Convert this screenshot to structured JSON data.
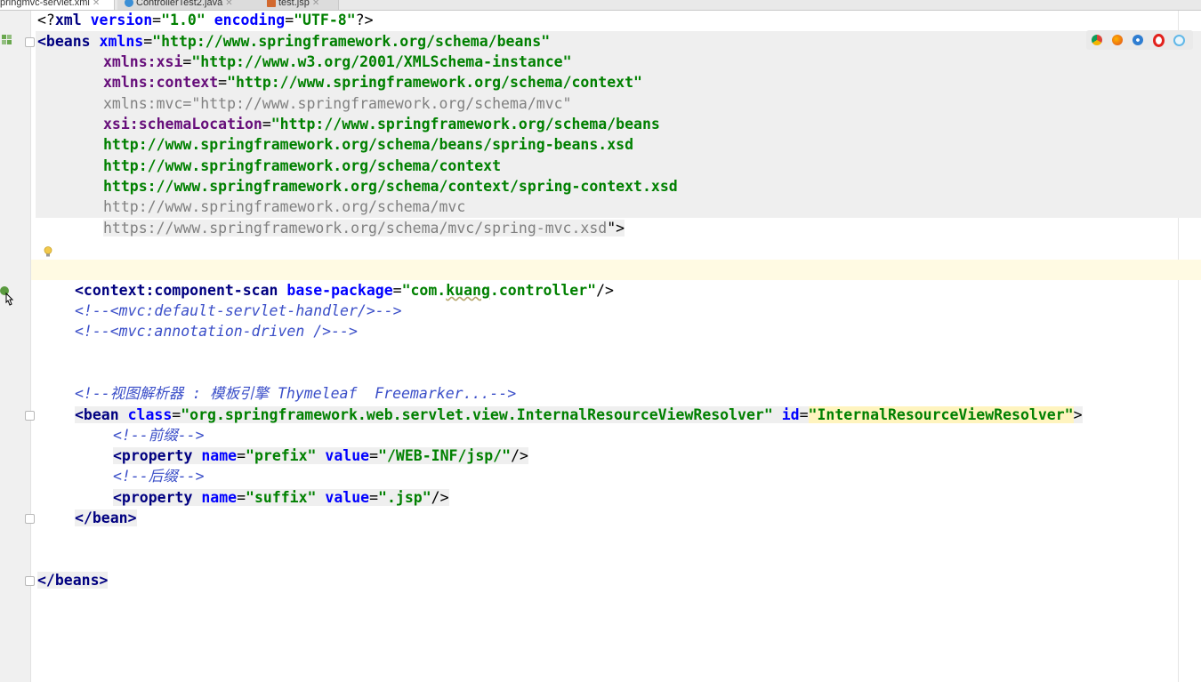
{
  "tabs": [
    {
      "label": "pringmvc-servlet.xml"
    },
    {
      "label": "ControllerTest2.java"
    },
    {
      "label": "test.jsp"
    }
  ],
  "browser_icons": [
    "chrome-icon",
    "firefox-icon",
    "safari-icon",
    "opera-icon",
    "ie-icon"
  ],
  "code": {
    "l1_decl_open": "<?",
    "l1_xml": "xml",
    "l1_version_attr": " version",
    "l1_eq": "=",
    "l1_version_val": "\"1.0\"",
    "l1_encoding_attr": " encoding",
    "l1_encoding_val": "\"UTF-8\"",
    "l1_decl_close": "?>",
    "l2_open": "<beans",
    "l2_attr": " xmlns",
    "l2_val": "\"http://www.springframework.org/schema/beans\"",
    "l3_attr": "xmlns:xsi",
    "l3_val": "\"http://www.w3.org/2001/XMLSchema-instance\"",
    "l4_attr": "xmlns:context",
    "l4_val": "\"http://www.springframework.org/schema/context\"",
    "l5_text": "xmlns:mvc=\"http://www.springframework.org/schema/mvc\"",
    "l6_attr": "xsi:schemaLocation",
    "l6_val": "\"http://www.springframework.org/schema/beans",
    "l7_val": "http://www.springframework.org/schema/beans/spring-beans.xsd",
    "l8_val": "http://www.springframework.org/schema/context",
    "l9_val": "https://www.springframework.org/schema/context/spring-context.xsd",
    "l10_text": "http://www.springframework.org/schema/mvc",
    "l11_text": "https://www.springframework.org/schema/mvc/spring-mvc.xsd",
    "l11_end": "\">",
    "cs_open": "<context:component-scan",
    "cs_attr": " base-package",
    "cs_val_a": "\"com.",
    "cs_val_b": "kuang",
    "cs_val_c": ".controller\"",
    "cs_close": "/>",
    "cmt1": "<!--<mvc:default-servlet-handler/>-->",
    "cmt2": "<!--<mvc:annotation-driven />-->",
    "cmt3": "<!--视图解析器 : 模板引擎 Thymeleaf  Freemarker...-->",
    "bean_open": "<bean",
    "bean_class_attr": " class",
    "bean_class_val": "\"org.springframework.web.servlet.view.InternalResourceViewResolver\"",
    "bean_id_attr": " id",
    "bean_id_val": "\"InternalResourceViewResolver\"",
    "bean_gt": ">",
    "cmt_prefix": "<!--前缀-->",
    "prop_open": "<property",
    "name_attr": " name",
    "prefix_name_val": "\"prefix\"",
    "value_attr": " value",
    "prefix_value_val": "\"/WEB-INF/jsp/\"",
    "prop_close": "/>",
    "cmt_suffix": "<!--后缀-->",
    "suffix_name_val": "\"suffix\"",
    "suffix_value_val": "\".jsp\"",
    "bean_end": "</bean>",
    "beans_end": "</beans>"
  }
}
